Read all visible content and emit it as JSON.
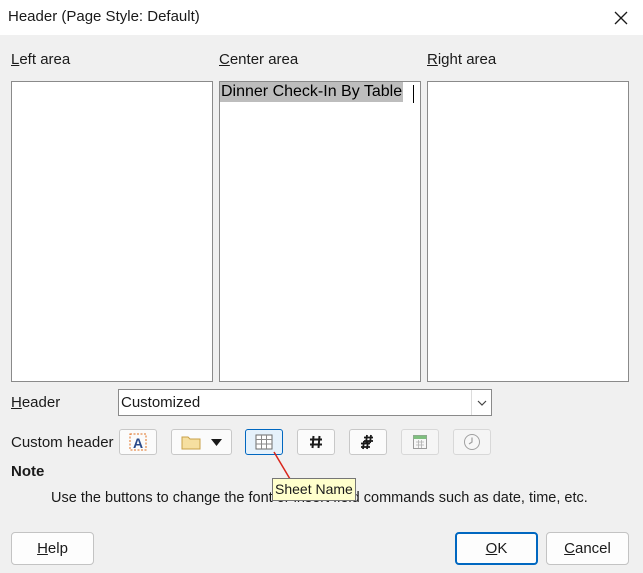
{
  "window": {
    "title": "Header (Page Style: Default)",
    "close_icon": "close-icon"
  },
  "areas": {
    "left": {
      "label_ul": "L",
      "label_rest": "eft area",
      "content": ""
    },
    "center": {
      "label_ul": "C",
      "label_rest": "enter area",
      "content": "Dinner Check-In By Table"
    },
    "right": {
      "label_ul": "R",
      "label_rest": "ight area",
      "content": ""
    }
  },
  "header_field": {
    "label_ul": "H",
    "label_rest": "eader",
    "selected": "Customized"
  },
  "custom_header": {
    "label": "Custom header",
    "buttons": [
      {
        "name": "text-attributes",
        "icon": "text-attributes-icon"
      },
      {
        "name": "file-name",
        "icon": "folder-icon"
      },
      {
        "name": "sheet-name",
        "icon": "sheet-name-icon",
        "active": true
      },
      {
        "name": "page",
        "icon": "page-icon"
      },
      {
        "name": "pages",
        "icon": "pages-icon"
      },
      {
        "name": "date",
        "icon": "date-icon",
        "disabled": true
      },
      {
        "name": "time",
        "icon": "clock-icon",
        "disabled": true
      }
    ],
    "tooltip": "Sheet Name"
  },
  "note": {
    "title": "Note",
    "text": "Use the buttons to change the font or insert field commands such as date, time, etc."
  },
  "buttons": {
    "help": {
      "ul": "H",
      "rest": "elp"
    },
    "ok": {
      "ul": "O",
      "rest": "K"
    },
    "cancel": {
      "ul": "C",
      "rest": "ancel"
    }
  },
  "colors": {
    "dialog_bg": "#f0f0f0",
    "accent": "#0067c0",
    "selection": "#bdbdbd",
    "tooltip_bg": "#ffffcc",
    "tooltip_pointer": "#d9261c"
  }
}
